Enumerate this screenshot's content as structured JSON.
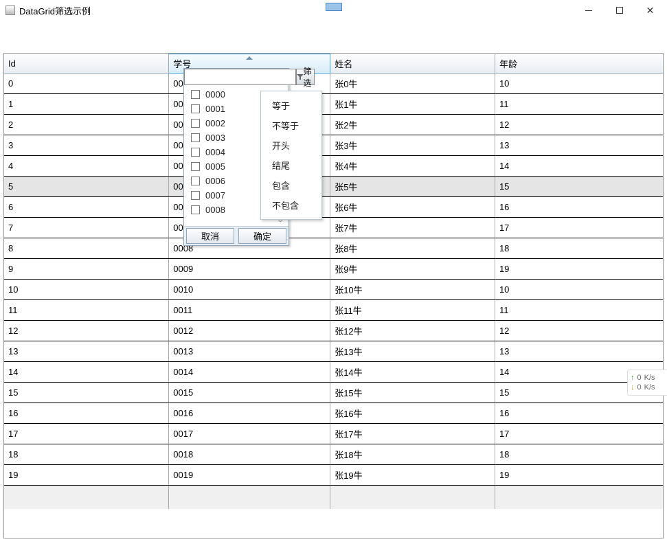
{
  "window": {
    "title": "DataGrid筛选示例"
  },
  "columns": [
    "Id",
    "学号",
    "姓名",
    "年龄"
  ],
  "rows": [
    {
      "id": "0",
      "code": "0000",
      "name": "张0牛",
      "age": "10"
    },
    {
      "id": "1",
      "code": "0001",
      "name": "张1牛",
      "age": "11"
    },
    {
      "id": "2",
      "code": "0002",
      "name": "张2牛",
      "age": "12"
    },
    {
      "id": "3",
      "code": "0003",
      "name": "张3牛",
      "age": "13"
    },
    {
      "id": "4",
      "code": "0004",
      "name": "张4牛",
      "age": "14"
    },
    {
      "id": "5",
      "code": "0005",
      "name": "张5牛",
      "age": "15"
    },
    {
      "id": "6",
      "code": "0006",
      "name": "张6牛",
      "age": "16"
    },
    {
      "id": "7",
      "code": "0007",
      "name": "张7牛",
      "age": "17"
    },
    {
      "id": "8",
      "code": "0008",
      "name": "张8牛",
      "age": "18"
    },
    {
      "id": "9",
      "code": "0009",
      "name": "张9牛",
      "age": "19"
    },
    {
      "id": "10",
      "code": "0010",
      "name": "张10牛",
      "age": "10"
    },
    {
      "id": "11",
      "code": "0011",
      "name": "张11牛",
      "age": "11"
    },
    {
      "id": "12",
      "code": "0012",
      "name": "张12牛",
      "age": "12"
    },
    {
      "id": "13",
      "code": "0013",
      "name": "张13牛",
      "age": "13"
    },
    {
      "id": "14",
      "code": "0014",
      "name": "张14牛",
      "age": "14"
    },
    {
      "id": "15",
      "code": "0015",
      "name": "张15牛",
      "age": "15"
    },
    {
      "id": "16",
      "code": "0016",
      "name": "张16牛",
      "age": "16"
    },
    {
      "id": "17",
      "code": "0017",
      "name": "张17牛",
      "age": "17"
    },
    {
      "id": "18",
      "code": "0018",
      "name": "张18牛",
      "age": "18"
    },
    {
      "id": "19",
      "code": "0019",
      "name": "张19牛",
      "age": "19"
    }
  ],
  "highlight_row_index": 5,
  "filter_popup": {
    "button_label": "筛选",
    "input_value": "",
    "options": [
      "0000",
      "0001",
      "0002",
      "0003",
      "0004",
      "0005",
      "0006",
      "0007",
      "0008"
    ],
    "cancel_label": "取消",
    "ok_label": "确定"
  },
  "filter_ops": [
    "等于",
    "不等于",
    "开头",
    "结尾",
    "包含",
    "不包含"
  ],
  "net": {
    "up": {
      "value": "0",
      "unit": "K/s"
    },
    "down": {
      "value": "0",
      "unit": "K/s"
    }
  }
}
